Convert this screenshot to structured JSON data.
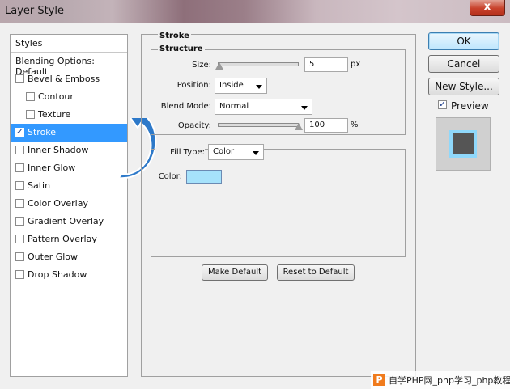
{
  "window": {
    "title": "Layer Style",
    "close_glyph": "x"
  },
  "styles_panel": {
    "header": "Styles",
    "blending_options": "Blending Options: Default",
    "items": [
      {
        "label": "Bevel & Emboss",
        "checked": false,
        "indent": false
      },
      {
        "label": "Contour",
        "checked": false,
        "indent": true
      },
      {
        "label": "Texture",
        "checked": false,
        "indent": true
      },
      {
        "label": "Stroke",
        "checked": true,
        "indent": false,
        "selected": true
      },
      {
        "label": "Inner Shadow",
        "checked": false,
        "indent": false
      },
      {
        "label": "Inner Glow",
        "checked": false,
        "indent": false
      },
      {
        "label": "Satin",
        "checked": false,
        "indent": false
      },
      {
        "label": "Color Overlay",
        "checked": false,
        "indent": false
      },
      {
        "label": "Gradient Overlay",
        "checked": false,
        "indent": false
      },
      {
        "label": "Pattern Overlay",
        "checked": false,
        "indent": false
      },
      {
        "label": "Outer Glow",
        "checked": false,
        "indent": false
      },
      {
        "label": "Drop Shadow",
        "checked": false,
        "indent": false
      }
    ]
  },
  "stroke": {
    "title": "Stroke",
    "structure_title": "Structure",
    "size_label": "Size:",
    "size_value": "5",
    "size_unit": "px",
    "size_slider_fraction": 0.02,
    "position_label": "Position:",
    "position_value": "Inside",
    "blend_mode_label": "Blend Mode:",
    "blend_mode_value": "Normal",
    "opacity_label": "Opacity:",
    "opacity_value": "100",
    "opacity_unit": "%",
    "opacity_slider_fraction": 1.0,
    "fill_type_label": "Fill Type:",
    "fill_type_value": "Color",
    "color_label": "Color:",
    "color_value": "#a6e2fb",
    "make_default": "Make Default",
    "reset_to_default": "Reset to Default"
  },
  "buttons": {
    "ok": "OK",
    "cancel": "Cancel",
    "new_style": "New Style..."
  },
  "preview": {
    "label": "Preview",
    "checked": true
  },
  "watermark": {
    "logo": "P",
    "text": "自学PHP网_php学习_php教程"
  },
  "colors": {
    "selection": "#3399ff",
    "arrow": "#2d79c9",
    "stroke_color": "#a6e2fb"
  }
}
